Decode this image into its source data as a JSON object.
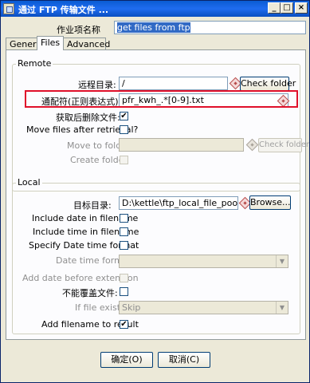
{
  "window": {
    "title": "通过 FTP 传输文件 ...",
    "buttons": {
      "minimize": "_",
      "maximize": "□",
      "close": "×"
    }
  },
  "job_entry": {
    "label": "作业项名称",
    "value": "get files from ftp"
  },
  "tabs": [
    {
      "label": "General",
      "active": false
    },
    {
      "label": "Files",
      "active": true
    },
    {
      "label": "Advanced",
      "active": false
    }
  ],
  "remote": {
    "group_label": "Remote",
    "remote_dir_label": "远程目录:",
    "remote_dir_value": "/",
    "check_folder": "Check folder",
    "wildcard_label": "通配符(正则表达式):",
    "wildcard_value": "pfr_kwh_.*[0-9].txt",
    "delete_after_label": "获取后删除文件:",
    "delete_after_checked": true,
    "move_after_label": "Move files after retrieval?",
    "move_after_checked": false,
    "move_to_label": "Move to folder",
    "move_to_value": "",
    "move_check_folder": "Check folder",
    "create_folder_label": "Create folder",
    "create_folder_checked": false
  },
  "local": {
    "group_label": "Local",
    "target_dir_label": "目标目录:",
    "target_dir_value": "D:\\kettle\\ftp_local_file_pool",
    "browse": "Browse...",
    "include_date_label": "Include date in filename",
    "include_date_checked": false,
    "include_time_label": "Include time in filename",
    "include_time_checked": false,
    "specify_format_label": "Specify Date time format",
    "specify_format_checked": false,
    "date_format_label": "Date time format",
    "date_format_value": "",
    "add_before_ext_label": "Add date before extension",
    "add_before_ext_checked": false,
    "no_overwrite_label": "不能覆盖文件:",
    "no_overwrite_checked": false,
    "if_exists_label": "If file exists",
    "if_exists_value": "Skip",
    "add_to_result_label": "Add filename to result",
    "add_to_result_checked": true
  },
  "footer": {
    "ok": "确定(O)",
    "cancel": "取消(C)"
  },
  "colors": {
    "highlight_box": "#e0102a",
    "title_blue": "#0a5bd3"
  }
}
